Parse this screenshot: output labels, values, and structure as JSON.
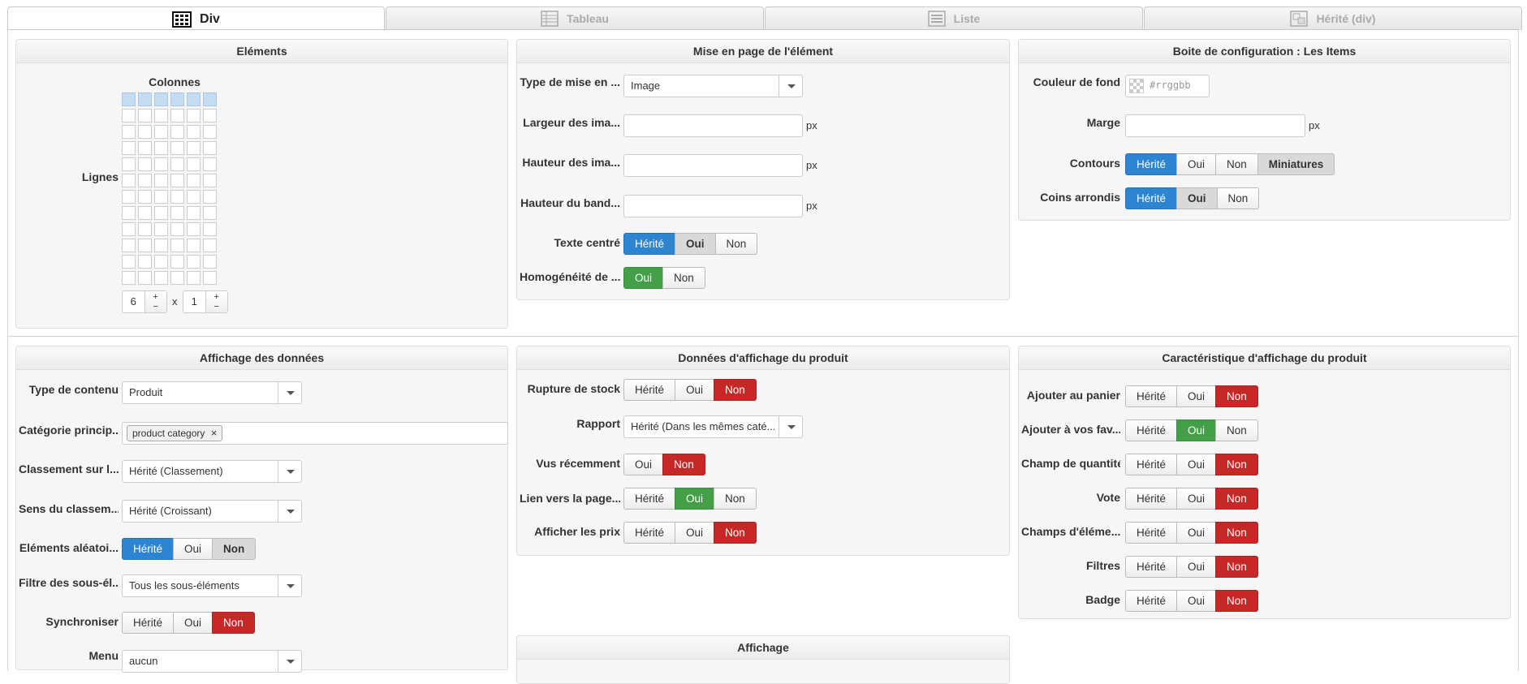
{
  "tabs": [
    {
      "label": "Div",
      "icon": "grid-icon"
    },
    {
      "label": "Tableau",
      "icon": "table-icon"
    },
    {
      "label": "Liste",
      "icon": "list-icon"
    },
    {
      "label": "Hérité (div)",
      "icon": "inherit-icon"
    }
  ],
  "elements": {
    "title": "Eléments",
    "columns_label": "Colonnes",
    "rows_label": "Lignes",
    "columns_value": "6",
    "rows_value": "1",
    "times": "x",
    "plus": "+",
    "minus": "−"
  },
  "layout": {
    "title": "Mise en page de l'élément",
    "type_label": "Type de mise en ...",
    "type_value": "Image",
    "width_label": "Largeur des ima...",
    "height_label": "Hauteur des ima...",
    "band_label": "Hauteur du band...",
    "unit": "px",
    "centered_label": "Texte centré",
    "centered_options": [
      "Hérité",
      "Oui",
      "Non"
    ],
    "homog_label": "Homogénéité de ...",
    "homog_options": [
      "Oui",
      "Non"
    ]
  },
  "config": {
    "title": "Boite de configuration : Les Items",
    "bg_label": "Couleur de fond",
    "bg_placeholder": "#rrggbb",
    "margin_label": "Marge",
    "unit": "px",
    "borders_label": "Contours",
    "borders_options": [
      "Hérité",
      "Oui",
      "Non",
      "Miniatures"
    ],
    "rounded_label": "Coins arrondis",
    "rounded_options": [
      "Hérité",
      "Oui",
      "Non"
    ]
  },
  "display": {
    "title": "Affichage des données",
    "content_type_label": "Type de contenu",
    "content_type_value": "Produit",
    "category_label": "Catégorie princip...",
    "category_tag": "product category",
    "tag_remove": "×",
    "sort_label": "Classement sur l...",
    "sort_value": "Hérité (Classement)",
    "direction_label": "Sens du classem...",
    "direction_value": "Hérité (Croissant)",
    "random_label": "Eléments aléatoi...",
    "random_options": [
      "Hérité",
      "Oui",
      "Non"
    ],
    "filter_label": "Filtre des sous-él...",
    "filter_value": "Tous les sous-éléments",
    "sync_label": "Synchroniser",
    "sync_options": [
      "Hérité",
      "Oui",
      "Non"
    ],
    "menu_label": "Menu",
    "menu_value": "aucun"
  },
  "product_data": {
    "title": "Données d'affichage du produit",
    "stock_label": "Rupture de stock",
    "stock_options": [
      "Hérité",
      "Oui",
      "Non"
    ],
    "report_label": "Rapport",
    "report_value": "Hérité (Dans les mêmes caté...",
    "recent_label": "Vus récemment",
    "recent_options": [
      "Oui",
      "Non"
    ],
    "link_label": "Lien vers la page...",
    "link_options": [
      "Hérité",
      "Oui",
      "Non"
    ],
    "prices_label": "Afficher les prix",
    "prices_options": [
      "Hérité",
      "Oui",
      "Non"
    ]
  },
  "product_features": {
    "title": "Caractéristique d'affichage du produit",
    "cart_label": "Ajouter au panier",
    "cart_options": [
      "Hérité",
      "Oui",
      "Non"
    ],
    "fav_label": "Ajouter à vos fav...",
    "fav_options": [
      "Hérité",
      "Oui",
      "Non"
    ],
    "qty_label": "Champ de quantité",
    "qty_options": [
      "Hérité",
      "Oui",
      "Non"
    ],
    "vote_label": "Vote",
    "vote_options": [
      "Hérité",
      "Oui",
      "Non"
    ],
    "fields_label": "Champs d'éléme...",
    "fields_options": [
      "Hérité",
      "Oui",
      "Non"
    ],
    "filters_label": "Filtres",
    "filters_options": [
      "Hérité",
      "Oui",
      "Non"
    ],
    "badge_label": "Badge",
    "badge_options": [
      "Hérité",
      "Oui",
      "Non"
    ]
  },
  "affichage": {
    "title": "Affichage"
  },
  "colors": {
    "accent_blue": "#2d84d1",
    "success_green": "#43a047",
    "danger_red": "#c62828"
  }
}
